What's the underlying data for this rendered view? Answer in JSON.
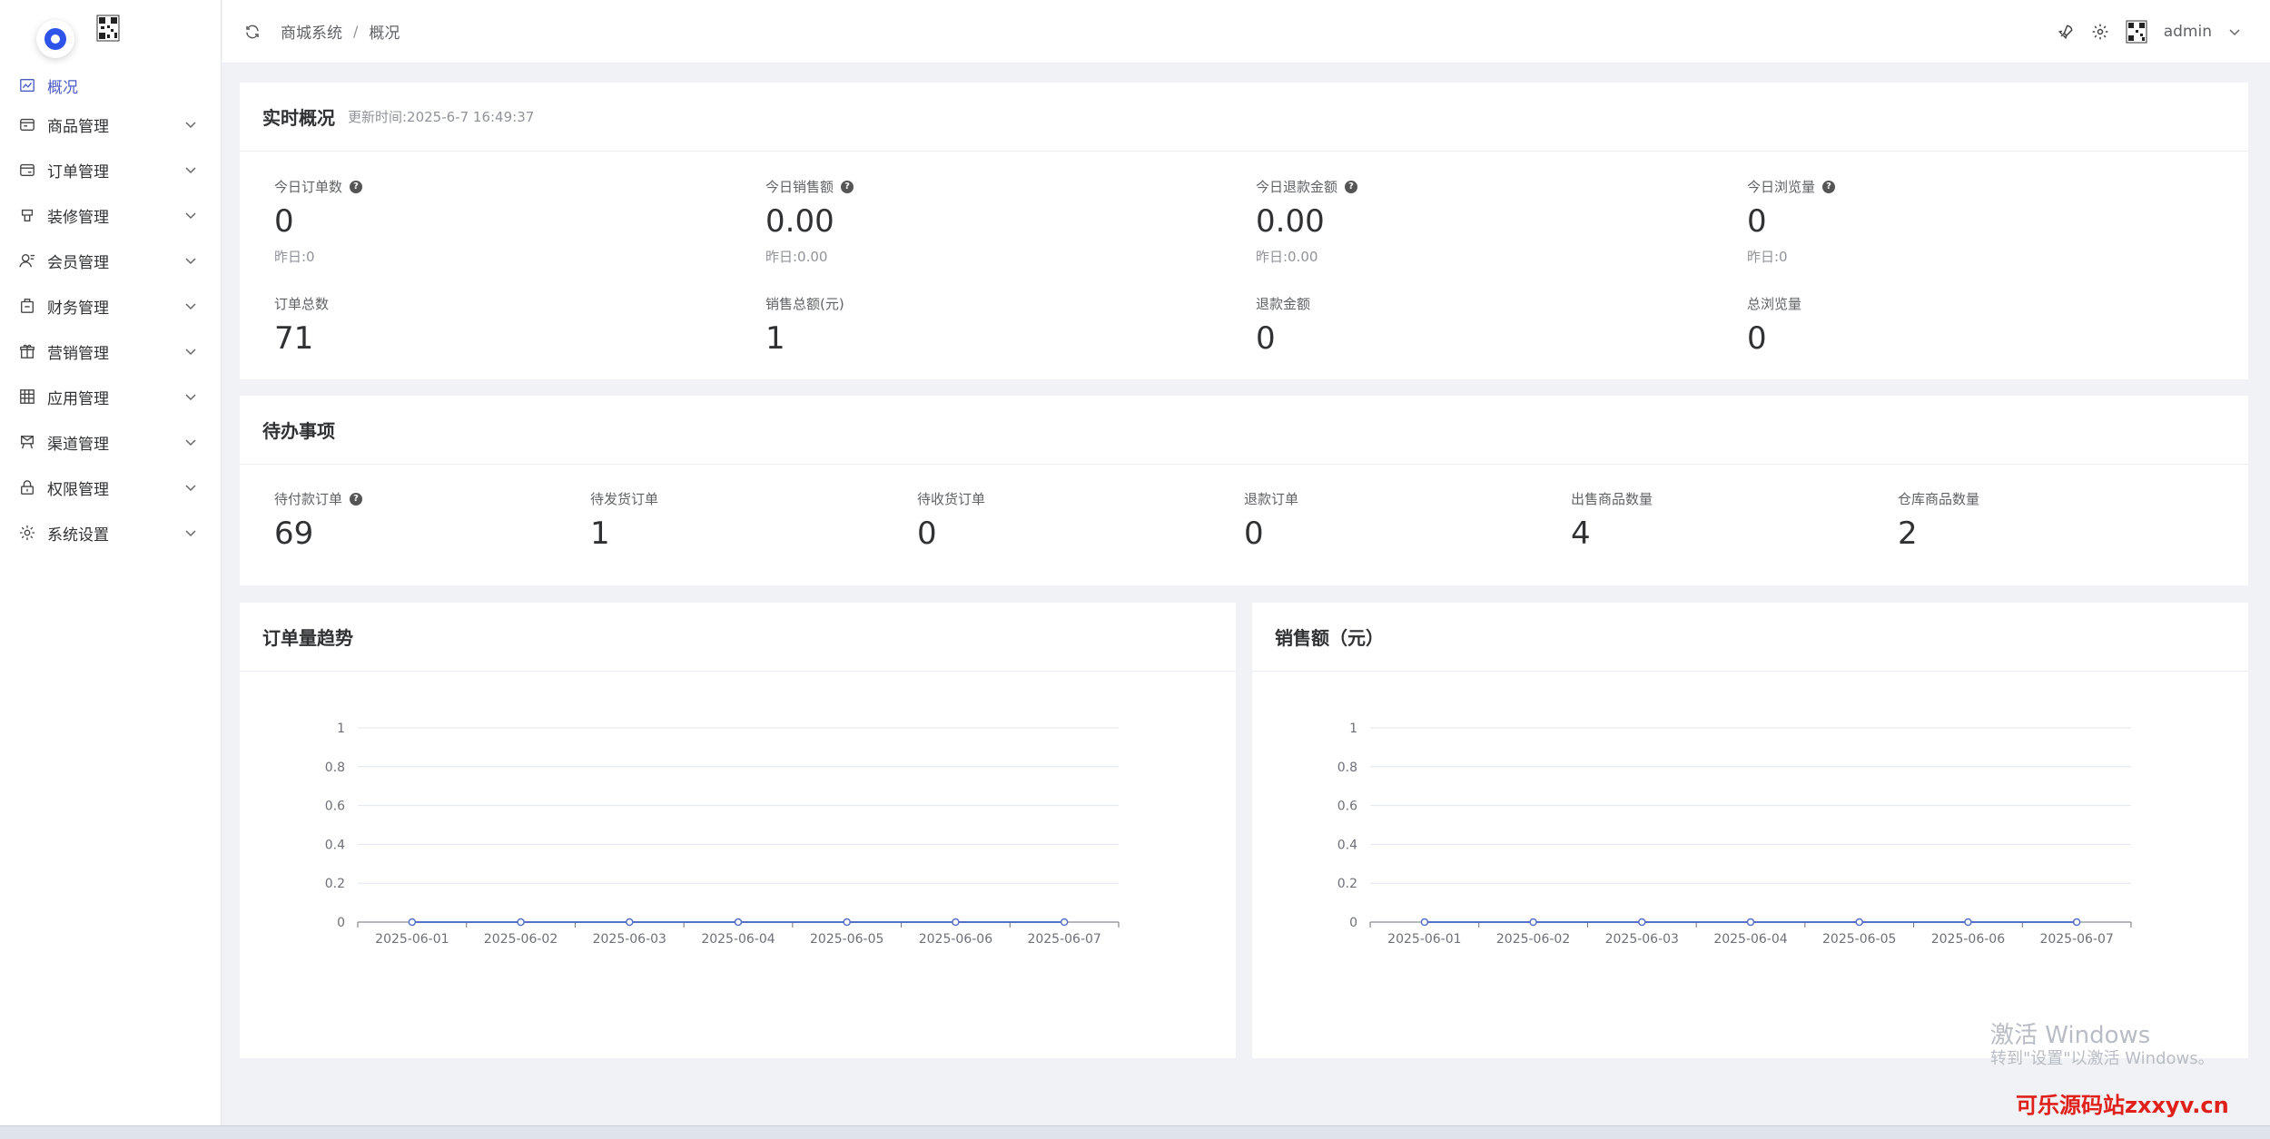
{
  "sidebar": {
    "items": [
      {
        "label": "概况",
        "icon": "chart-icon",
        "active": true
      },
      {
        "label": "商品管理",
        "icon": "goods-icon"
      },
      {
        "label": "订单管理",
        "icon": "order-icon"
      },
      {
        "label": "装修管理",
        "icon": "decorate-icon"
      },
      {
        "label": "会员管理",
        "icon": "member-icon"
      },
      {
        "label": "财务管理",
        "icon": "finance-icon"
      },
      {
        "label": "营销管理",
        "icon": "gift-icon"
      },
      {
        "label": "应用管理",
        "icon": "grid-icon"
      },
      {
        "label": "渠道管理",
        "icon": "channel-icon"
      },
      {
        "label": "权限管理",
        "icon": "lock-icon"
      },
      {
        "label": "系统设置",
        "icon": "gear-icon"
      }
    ]
  },
  "header": {
    "breadcrumb": [
      "商城系统",
      "概况"
    ],
    "separator": "/",
    "user": "admin"
  },
  "realtime": {
    "title": "实时概况",
    "updated": "更新时间:2025-6-7 16:49:37",
    "today": [
      {
        "label": "今日订单数",
        "value": "0",
        "sub": "昨日:0"
      },
      {
        "label": "今日销售额",
        "value": "0.00",
        "sub": "昨日:0.00"
      },
      {
        "label": "今日退款金额",
        "value": "0.00",
        "sub": "昨日:0.00"
      },
      {
        "label": "今日浏览量",
        "value": "0",
        "sub": "昨日:0"
      }
    ],
    "totals": [
      {
        "label": "订单总数",
        "value": "71"
      },
      {
        "label": "销售总额(元)",
        "value": "1"
      },
      {
        "label": "退款金额",
        "value": "0"
      },
      {
        "label": "总浏览量",
        "value": "0"
      }
    ]
  },
  "todo": {
    "title": "待办事项",
    "items": [
      {
        "label": "待付款订单",
        "value": "69"
      },
      {
        "label": "待发货订单",
        "value": "1"
      },
      {
        "label": "待收货订单",
        "value": "0"
      },
      {
        "label": "退款订单",
        "value": "0"
      },
      {
        "label": "出售商品数量",
        "value": "4"
      },
      {
        "label": "仓库商品数量",
        "value": "2"
      }
    ]
  },
  "charts": {
    "orders_title": "订单量趋势",
    "sales_title": "销售额（元）"
  },
  "chart_data": [
    {
      "type": "line",
      "title": "订单量趋势",
      "x": [
        "2025-06-01",
        "2025-06-02",
        "2025-06-03",
        "2025-06-04",
        "2025-06-05",
        "2025-06-06",
        "2025-06-07"
      ],
      "series": [
        {
          "values": [
            0,
            0,
            0,
            0,
            0,
            0,
            0
          ]
        }
      ],
      "ylim": [
        0,
        1
      ],
      "yticks": [
        "0",
        "0.2",
        "0.4",
        "0.6",
        "0.8",
        "1"
      ],
      "grid": true,
      "color": "#5470c6"
    },
    {
      "type": "line",
      "title": "销售额（元）",
      "x": [
        "2025-06-01",
        "2025-06-02",
        "2025-06-03",
        "2025-06-04",
        "2025-06-05",
        "2025-06-06",
        "2025-06-07"
      ],
      "series": [
        {
          "values": [
            0,
            0,
            0,
            0,
            0,
            0,
            0
          ]
        }
      ],
      "ylim": [
        0,
        1
      ],
      "yticks": [
        "0",
        "0.2",
        "0.4",
        "0.6",
        "0.8",
        "1"
      ],
      "grid": true,
      "color": "#5470c6"
    }
  ],
  "watermark": {
    "line1": "激活 Windows",
    "line2": "转到\"设置\"以激活 Windows。",
    "line3": "可乐源码站zxxyv.cn"
  }
}
